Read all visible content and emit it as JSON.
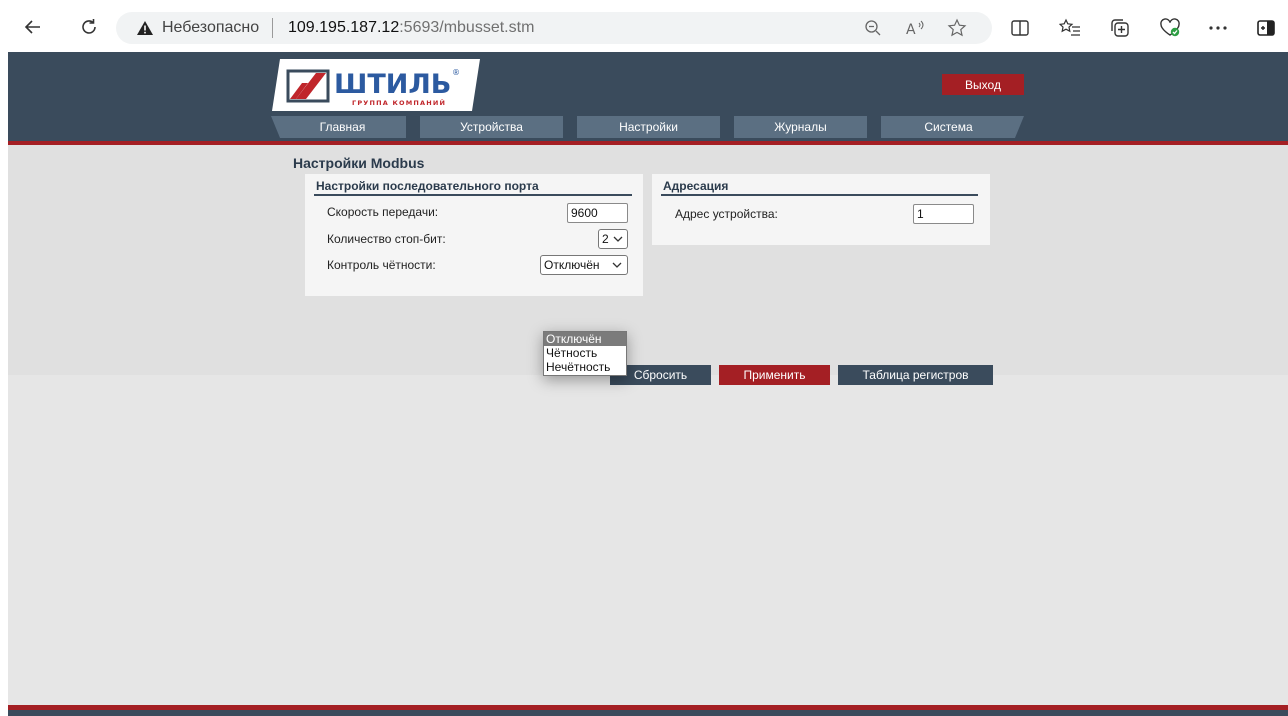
{
  "browser": {
    "security_label": "Небезопасно",
    "url_host": "109.195.187.12",
    "url_rest": ":5693/mbusset.stm",
    "icons": [
      "back-icon",
      "refresh-icon",
      "warning-icon",
      "zoom-out-icon",
      "read-aloud-icon",
      "favorite-star-icon",
      "split-screen-icon",
      "favorites-list-icon",
      "collections-icon",
      "browser-essentials-icon",
      "more-icon",
      "sidebar-icon"
    ]
  },
  "header": {
    "logo_text": "ШТИЛЬ",
    "logo_subtitle": "ГРУППА КОМПАНИЙ",
    "exit_label": "Выход",
    "menu": [
      {
        "label": "Главная"
      },
      {
        "label": "Устройства"
      },
      {
        "label": "Настройки"
      },
      {
        "label": "Журналы"
      },
      {
        "label": "Система"
      }
    ]
  },
  "page": {
    "title": "Настройки Modbus",
    "serial": {
      "title": "Настройки последовательного порта",
      "baud_label": "Скорость передачи:",
      "baud_value": "9600",
      "stopbits_label": "Количество стоп-бит:",
      "stopbits_value": "2",
      "parity_label": "Контроль чётности:",
      "parity_value": "Отключён",
      "parity_options": [
        "Отключён",
        "Чётность",
        "Нечётность"
      ]
    },
    "addressing": {
      "title": "Адресация",
      "address_label": "Адрес устройства:",
      "address_value": "1"
    },
    "buttons": {
      "reset": "Сбросить",
      "apply": "Применить",
      "registers": "Таблица регистров"
    }
  },
  "colors": {
    "header_bg": "#3a4b5c",
    "menu_bg": "#5b6f82",
    "accent_red": "#a41f24",
    "page_bg": "#e6e6e6",
    "panel_bg": "#f5f5f5"
  }
}
